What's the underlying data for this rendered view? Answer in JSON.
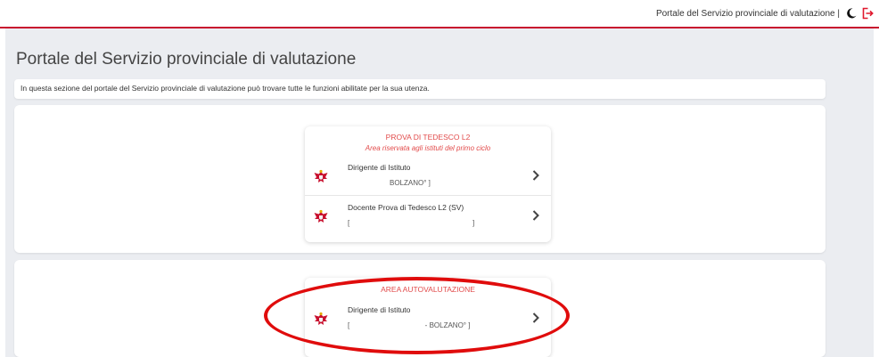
{
  "topbar": {
    "title": "Portale del Servizio provinciale di valutazione |",
    "moon_icon": "moon-icon",
    "logout_icon": "logout-icon",
    "accent_color": "#c8102e"
  },
  "main": {
    "page_title": "Portale del Servizio provinciale di valutazione",
    "info_text": "In questa sezione del portale del Servizio provinciale di valutazione può trovare tutte le funzioni abilitate per la sua utenza."
  },
  "sections": [
    {
      "title": "PROVA DI TEDESCO L2",
      "subtitle": "Area riservata agli istituti del primo ciclo",
      "rows": [
        {
          "role": "Dirigente di Istituto",
          "detail": "BOLZANO° ]",
          "icon": "eagle-emblem-icon"
        },
        {
          "role": "Docente Prova di Tedesco L2 (SV)",
          "detail": "[                                                              ]",
          "icon": "eagle-emblem-icon"
        }
      ]
    },
    {
      "title": "AREA AUTOVALUTAZIONE",
      "rows": [
        {
          "role": "Dirigente di Istituto",
          "detail": "[                                      - BOLZANO° ]",
          "icon": "eagle-emblem-icon"
        }
      ]
    }
  ],
  "annotation": {
    "color": "#e00c0c"
  }
}
